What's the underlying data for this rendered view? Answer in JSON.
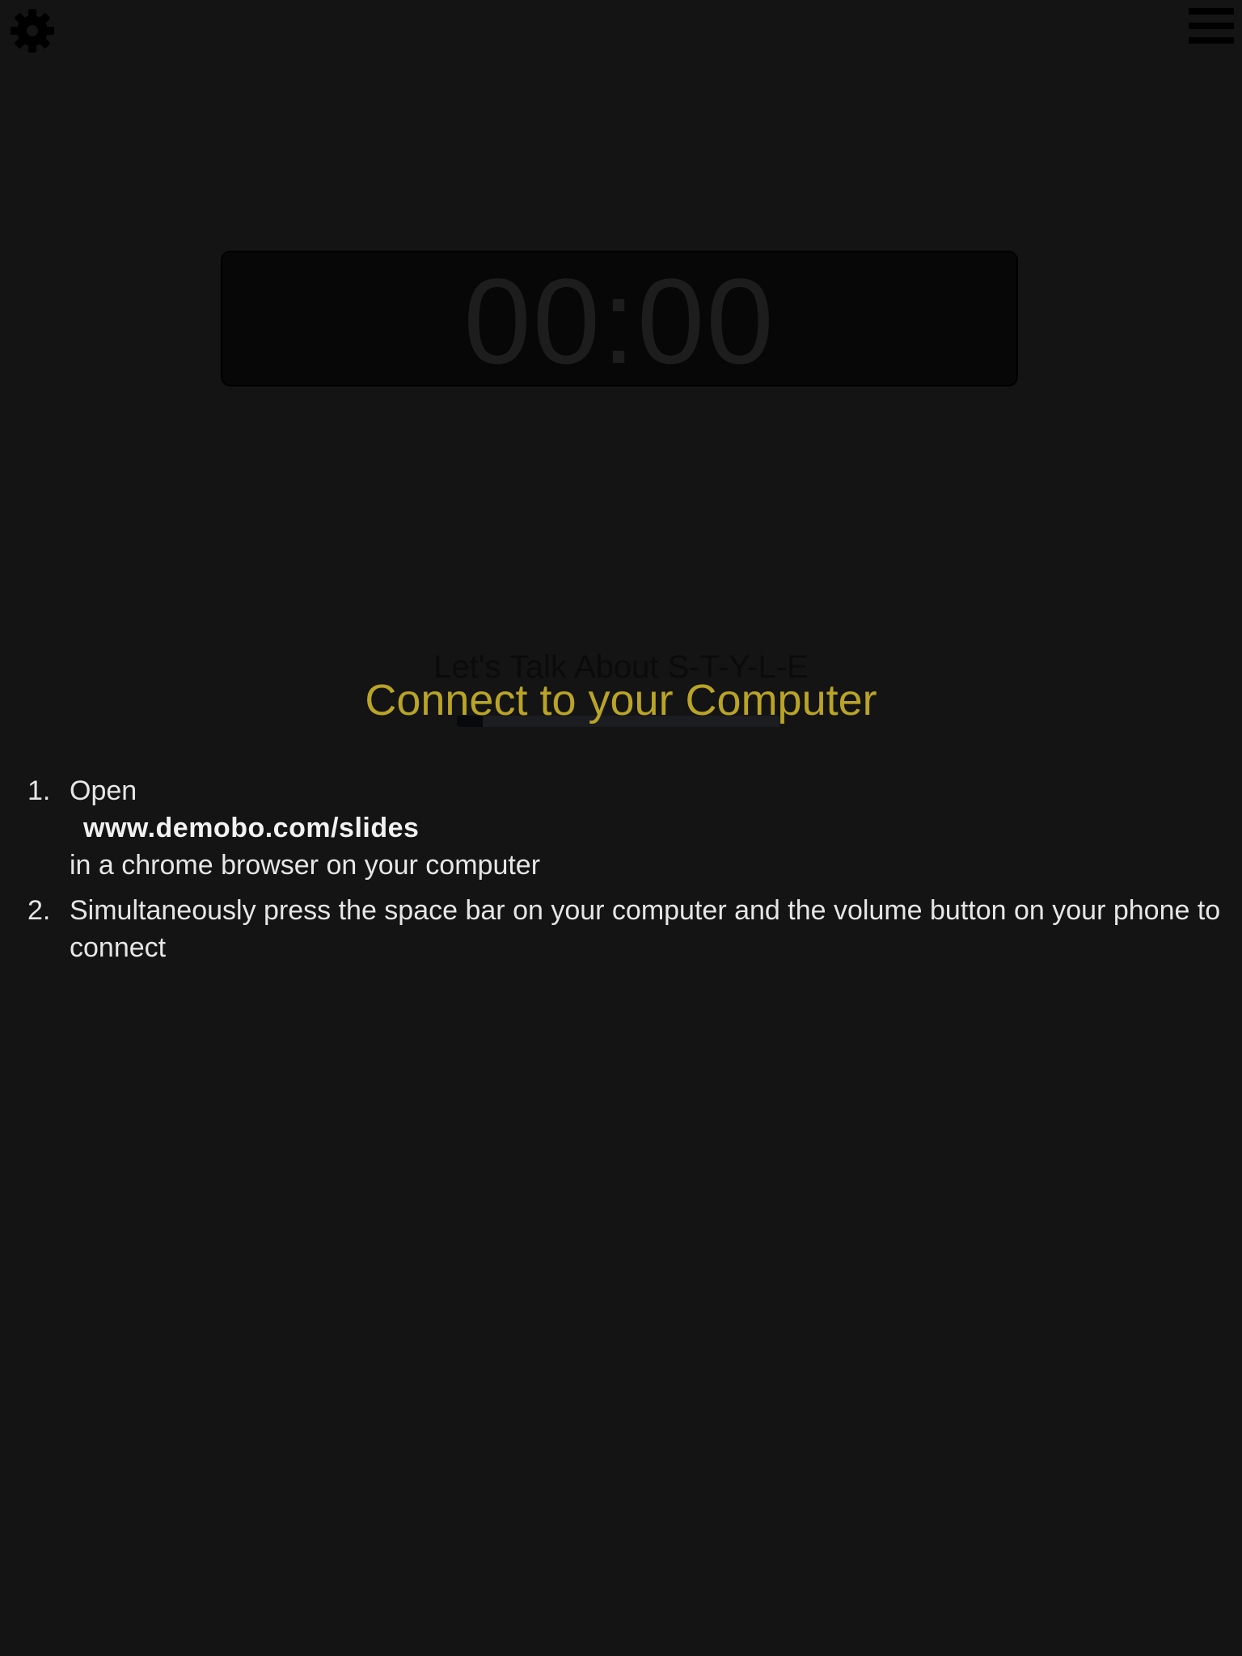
{
  "toolbar": {
    "settings_icon": "gear-icon",
    "menu_icon": "hamburger-menu-icon"
  },
  "timer": {
    "display": "00:00"
  },
  "slide": {
    "title": "Let's Talk About S-T-Y-L-E",
    "progress_fraction": 0.08
  },
  "connect": {
    "heading": "Connect to your Computer",
    "heading_color": "#b9a427",
    "steps": [
      {
        "number": "1.",
        "line1": "Open",
        "url": "www.demobo.com/slides",
        "line2": "in a chrome browser on your computer"
      },
      {
        "number": "2.",
        "text": "Simultaneously press the space bar on your computer and the volume button on your phone to connect"
      }
    ]
  },
  "colors": {
    "background": "#141414",
    "accent": "#b9a427",
    "text": "#e6e6e6"
  }
}
